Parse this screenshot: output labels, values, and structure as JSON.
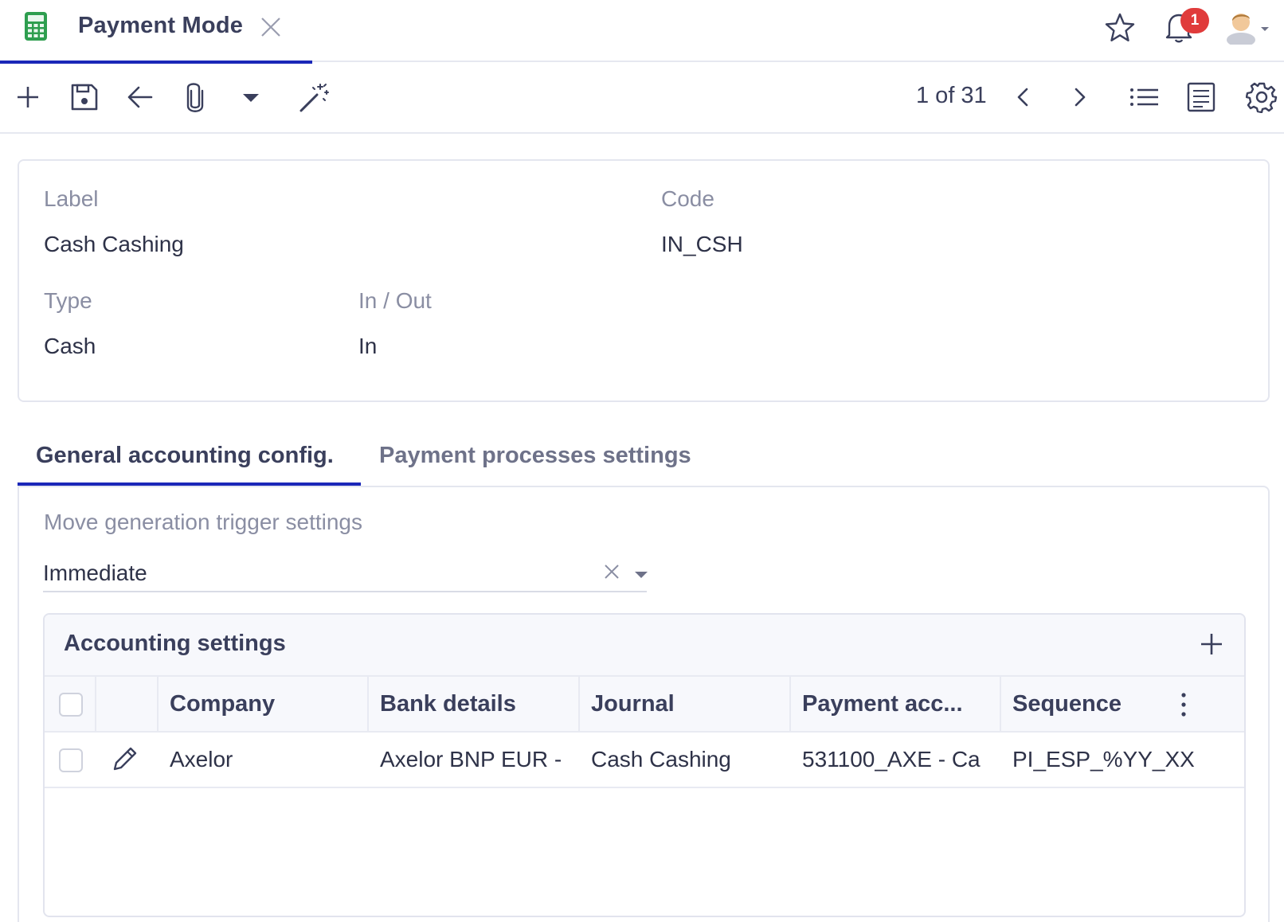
{
  "top_tab": {
    "title": "Payment Mode",
    "notification_count": "1",
    "icons": [
      "calculator-icon",
      "close-icon",
      "star-icon",
      "bell-icon",
      "avatar"
    ]
  },
  "toolbar": {
    "pager": "1 of 31",
    "icons": [
      "plus-icon",
      "save-icon",
      "back-arrow-icon",
      "paperclip-icon",
      "caret-down-icon",
      "magic-wand-icon",
      "chevron-left-icon",
      "chevron-right-icon",
      "list-view-icon",
      "form-view-icon",
      "gear-icon"
    ]
  },
  "record": {
    "label_caption": "Label",
    "label_value": "Cash Cashing",
    "code_caption": "Code",
    "code_value": "IN_CSH",
    "type_caption": "Type",
    "type_value": "Cash",
    "inout_caption": "In / Out",
    "inout_value": "In"
  },
  "tabs": [
    {
      "label": "General accounting config.",
      "active": true
    },
    {
      "label": "Payment processes settings",
      "active": false
    }
  ],
  "trigger": {
    "caption": "Move generation trigger settings",
    "value": "Immediate"
  },
  "accounting_settings": {
    "title": "Accounting settings",
    "columns": [
      "Company",
      "Bank details",
      "Journal",
      "Payment acc...",
      "Sequence"
    ],
    "rows": [
      {
        "company": "Axelor",
        "bank_details": "Axelor BNP EUR -",
        "journal": "Cash Cashing",
        "payment_account": "531100_AXE - Ca",
        "sequence": "PI_ESP_%YY_XX"
      }
    ]
  },
  "colors": {
    "accent": "#1a27b8",
    "badge": "#e03b3b",
    "calculator": "#2e9e4f"
  }
}
